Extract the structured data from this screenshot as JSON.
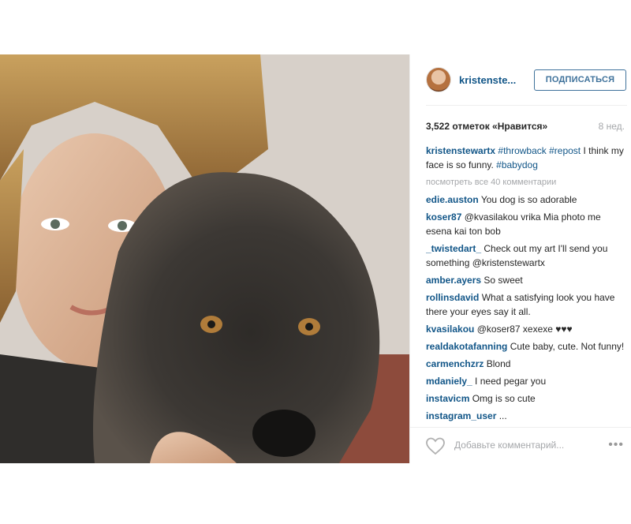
{
  "post": {
    "username": "kristenste...",
    "follow_label": "ПОДПИСАТЬСЯ",
    "likes_text": "3,522 отметок «Нравится»",
    "age": "8 нед.",
    "caption": {
      "user": "kristenstewartx",
      "tag1": "#throwback",
      "tag2": "#repost",
      "text": " I think my face is so funny. ",
      "tag3": "#babydog",
      "emoji": ""
    },
    "view_all": "посмотреть все 40 комментарии",
    "comments": [
      {
        "user": "edie.auston",
        "text": "You dog is so adorable "
      },
      {
        "user": "koser87",
        "text": "@kvasilakou vrika Mia photo me esena kai ton bob "
      },
      {
        "user": "_twistedart_",
        "text": "Check out my art I'll send you something @kristenstewartx"
      },
      {
        "user": "amber.ayers",
        "text": "So sweet"
      },
      {
        "user": "rollinsdavid",
        "text": "What a satisfying look you have there your eyes say it all."
      },
      {
        "user": "kvasilakou",
        "text": "@koser87 xexexe ♥♥♥"
      },
      {
        "user": "realdakotafanning",
        "text": "Cute baby, cute. Not funny! "
      },
      {
        "user": "carmenchzrz",
        "text": "Blond"
      },
      {
        "user": "mdaniely_",
        "text": "I need pegar you"
      },
      {
        "user": "instavicm",
        "text": "Omg is so cute"
      },
      {
        "user": "instagram_user",
        "text": "..."
      }
    ],
    "add_comment_placeholder": "Добавьте комментарий...",
    "more_label": "•••"
  },
  "colors": {
    "link": "#125688",
    "button": "#3f729b",
    "muted": "#a5a7aa"
  },
  "icons": {
    "like": "heart-icon",
    "more": "more-dots-icon"
  }
}
